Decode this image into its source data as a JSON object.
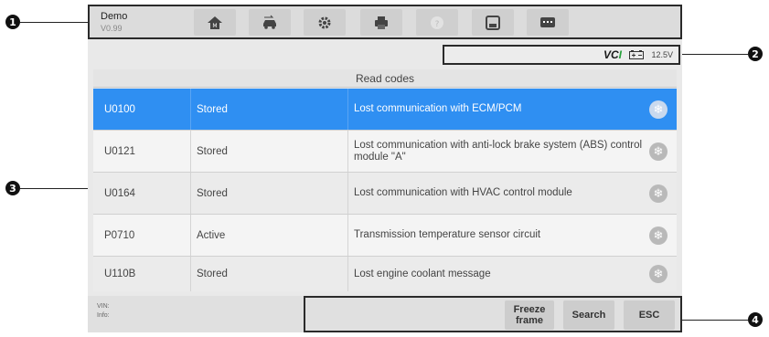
{
  "callouts": [
    "1",
    "2",
    "3",
    "4"
  ],
  "toolbar": {
    "app_name": "Demo",
    "app_version": "V0.99",
    "buttons": [
      "home-icon",
      "vehicle-swap-icon",
      "settings-icon",
      "print-icon",
      "help-icon",
      "save-icon",
      "data-logging-icon"
    ]
  },
  "status": {
    "vci_prefix": "VC",
    "vci_suffix": "I",
    "voltage": "12.5V"
  },
  "table": {
    "title": "Read codes",
    "rows": [
      {
        "code": "U0100",
        "status": "Stored",
        "description": "Lost communication with ECM/PCM",
        "selected": true
      },
      {
        "code": "U0121",
        "status": "Stored",
        "description": "Lost communication with anti-lock brake system (ABS) control module \"A\""
      },
      {
        "code": "U0164",
        "status": "Stored",
        "description": "Lost communication with HVAC control module"
      },
      {
        "code": "P0710",
        "status": "Active",
        "description": "Transmission temperature sensor circuit"
      },
      {
        "code": "U110B",
        "status": "Stored",
        "description": "Lost engine coolant message"
      }
    ]
  },
  "footer": {
    "vin_label": "VIN:",
    "info_label": "Info:",
    "freeze_frame": "Freeze frame",
    "search": "Search",
    "esc": "ESC"
  }
}
